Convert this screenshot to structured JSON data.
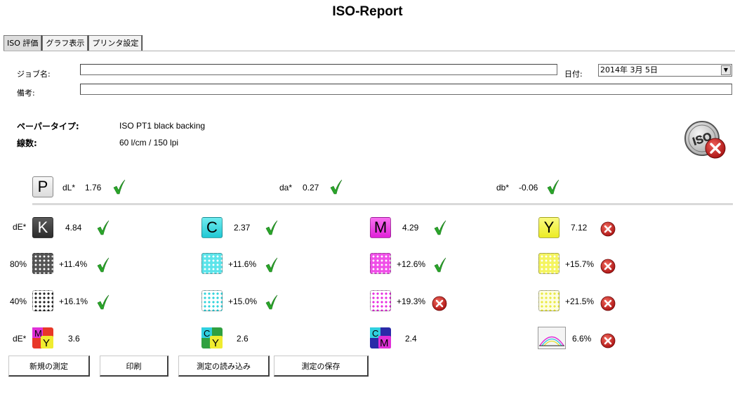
{
  "title": "ISO-Report",
  "tabs": [
    {
      "label": "ISO 評価",
      "active": true
    },
    {
      "label": "グラフ表示",
      "active": false
    },
    {
      "label": "プリンタ設定",
      "active": false
    }
  ],
  "form": {
    "job_label": "ジョブ名:",
    "job_value": "",
    "note_label": "備考:",
    "note_value": "",
    "date_label": "日付:",
    "date_value": "2014年  3月  5日"
  },
  "info": {
    "paper_label": "ペーパータイプ:",
    "paper_value": "ISO PT1 black backing",
    "screen_label": "線数:",
    "screen_value": "60 l/cm / 150 lpi"
  },
  "paper": {
    "tile": "P",
    "dl_label": "dL*",
    "dl_value": "1.76",
    "dl_status": "pass",
    "da_label": "da*",
    "da_value": "0.27",
    "da_status": "pass",
    "db_label": "db*",
    "db_value": "-0.06",
    "db_status": "pass"
  },
  "row_labels": {
    "solids": "dE*",
    "tv80": "80%",
    "tv40": "40%",
    "overprint": "dE*"
  },
  "solids": [
    {
      "tile": "K",
      "value": "4.84",
      "status": "pass",
      "color": "#444444"
    },
    {
      "tile": "C",
      "value": "2.37",
      "status": "pass",
      "color": "#3ed8e0"
    },
    {
      "tile": "M",
      "value": "4.29",
      "status": "pass",
      "color": "#f03ce6"
    },
    {
      "tile": "Y",
      "value": "7.12",
      "status": "fail",
      "color": "#f4f43a"
    }
  ],
  "tv80": [
    {
      "value": "+11.4%",
      "status": "pass"
    },
    {
      "value": "+11.6%",
      "status": "pass"
    },
    {
      "value": "+12.6%",
      "status": "pass"
    },
    {
      "value": "+15.7%",
      "status": "fail"
    }
  ],
  "tv40": [
    {
      "value": "+16.1%",
      "status": "pass"
    },
    {
      "value": "+15.0%",
      "status": "pass"
    },
    {
      "value": "+19.3%",
      "status": "fail"
    },
    {
      "value": "+21.5%",
      "status": "fail"
    }
  ],
  "overprints": [
    {
      "top": "M",
      "bottom": "Y",
      "value": "3.6"
    },
    {
      "top": "C",
      "bottom": "Y",
      "value": "2.6"
    },
    {
      "top": "C",
      "bottom": "M",
      "value": "2.4"
    },
    {
      "value": "6.6%",
      "status": "fail"
    }
  ],
  "buttons": {
    "new": "新規の測定",
    "print": "印刷",
    "load": "測定の読み込み",
    "save": "測定の保存"
  },
  "iso_badge": {
    "label": "ISO",
    "status": "fail"
  },
  "colors": {
    "pass": "#2aa52a",
    "fail": "#c81e1e"
  }
}
